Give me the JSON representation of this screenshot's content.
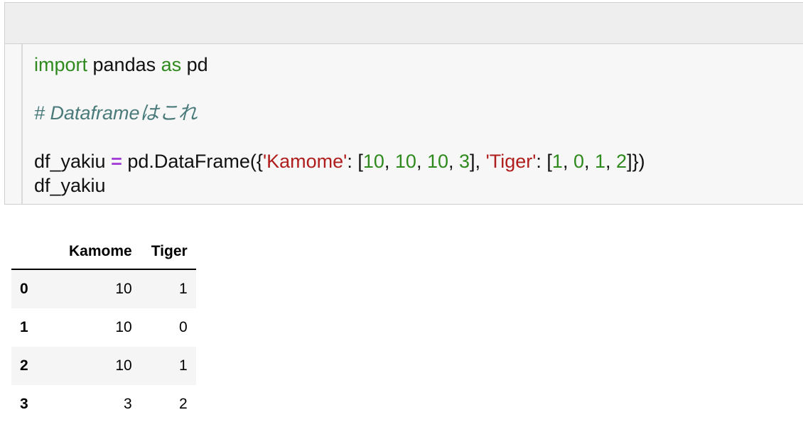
{
  "code": {
    "line1": {
      "kw_import": "import",
      "pandas": " pandas ",
      "kw_as": "as",
      "pd": " pd"
    },
    "comment": "# Dataframeはこれ",
    "line3": {
      "lhs": "df_yakiu ",
      "op": "=",
      "call": " pd.DataFrame({",
      "key1": "'Kamome'",
      "sep1": ": [",
      "v1": "10",
      "c1": ", ",
      "v2": "10",
      "c2": ", ",
      "v3": "10",
      "c3": ", ",
      "v4": "3",
      "sep2": "], ",
      "key2": "'Tiger'",
      "sep3": ": [",
      "w1": "1",
      "d1": ", ",
      "w2": "0",
      "d2": ", ",
      "w3": "1",
      "d3": ", ",
      "w4": "2",
      "end": "]})"
    },
    "line4": "df_yakiu"
  },
  "table": {
    "columns": [
      "Kamome",
      "Tiger"
    ],
    "rows": [
      {
        "index": "0",
        "Kamome": "10",
        "Tiger": "1"
      },
      {
        "index": "1",
        "Kamome": "10",
        "Tiger": "0"
      },
      {
        "index": "2",
        "Kamome": "10",
        "Tiger": "1"
      },
      {
        "index": "3",
        "Kamome": "3",
        "Tiger": "2"
      }
    ]
  }
}
